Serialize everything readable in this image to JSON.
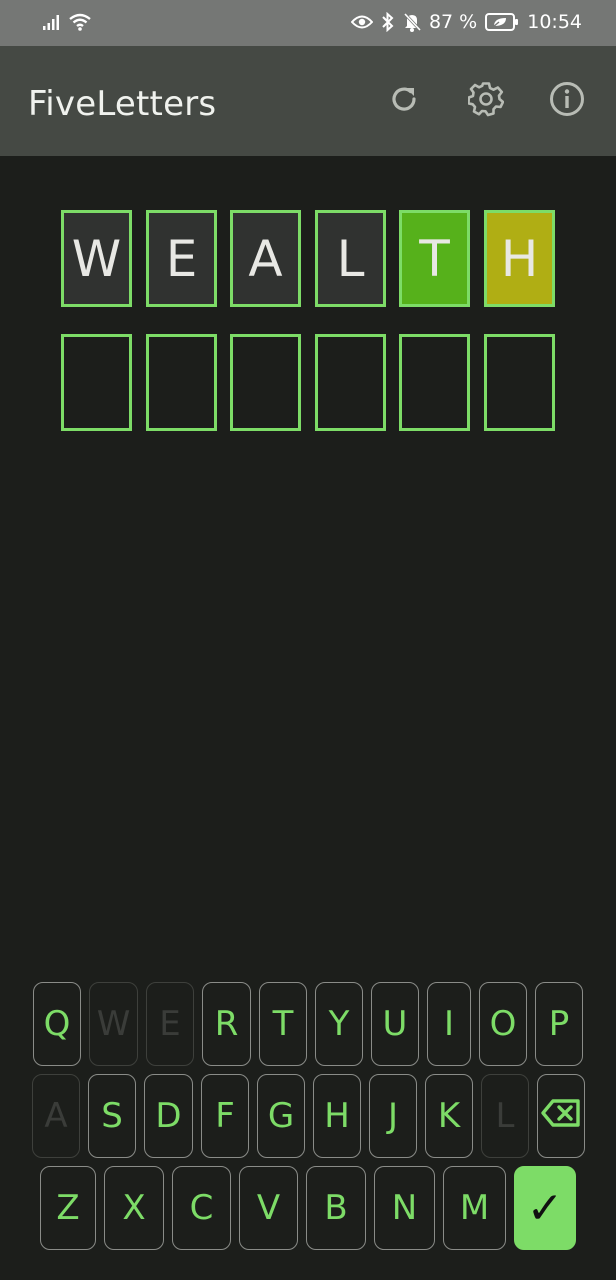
{
  "status_bar": {
    "battery": "87 %",
    "time": "10:54"
  },
  "app_bar": {
    "title": "FiveLetters",
    "actions": [
      "refresh-icon",
      "gear-icon",
      "info-icon"
    ]
  },
  "grid": {
    "rows": [
      [
        {
          "letter": "W",
          "state": "filled"
        },
        {
          "letter": "E",
          "state": "filled"
        },
        {
          "letter": "A",
          "state": "filled"
        },
        {
          "letter": "L",
          "state": "filled"
        },
        {
          "letter": "T",
          "state": "correct"
        },
        {
          "letter": "H",
          "state": "present"
        }
      ],
      [
        {
          "letter": "",
          "state": "empty"
        },
        {
          "letter": "",
          "state": "empty"
        },
        {
          "letter": "",
          "state": "empty"
        },
        {
          "letter": "",
          "state": "empty"
        },
        {
          "letter": "",
          "state": "empty"
        },
        {
          "letter": "",
          "state": "empty"
        }
      ]
    ]
  },
  "keyboard": {
    "row1": [
      {
        "label": "Q",
        "state": "available"
      },
      {
        "label": "W",
        "state": "used"
      },
      {
        "label": "E",
        "state": "used"
      },
      {
        "label": "R",
        "state": "available"
      },
      {
        "label": "T",
        "state": "available"
      },
      {
        "label": "Y",
        "state": "available"
      },
      {
        "label": "U",
        "state": "available"
      },
      {
        "label": "I",
        "state": "available"
      },
      {
        "label": "O",
        "state": "available"
      },
      {
        "label": "P",
        "state": "available"
      }
    ],
    "row2": [
      {
        "label": "A",
        "state": "used"
      },
      {
        "label": "S",
        "state": "available"
      },
      {
        "label": "D",
        "state": "available"
      },
      {
        "label": "F",
        "state": "available"
      },
      {
        "label": "G",
        "state": "available"
      },
      {
        "label": "H",
        "state": "available"
      },
      {
        "label": "J",
        "state": "available"
      },
      {
        "label": "K",
        "state": "available"
      },
      {
        "label": "L",
        "state": "used"
      },
      {
        "label": "",
        "state": "backspace",
        "icon": "backspace-icon"
      }
    ],
    "row3": [
      {
        "label": "Z",
        "state": "available"
      },
      {
        "label": "X",
        "state": "available"
      },
      {
        "label": "C",
        "state": "available"
      },
      {
        "label": "V",
        "state": "available"
      },
      {
        "label": "B",
        "state": "available"
      },
      {
        "label": "N",
        "state": "available"
      },
      {
        "label": "M",
        "state": "available"
      },
      {
        "label": "✓",
        "state": "enter"
      }
    ]
  },
  "colors": {
    "accent": "#7ddc67",
    "correct": "#56b11b",
    "present": "#b0ae14",
    "background": "#1c1e1b",
    "app_bar": "#454944"
  }
}
